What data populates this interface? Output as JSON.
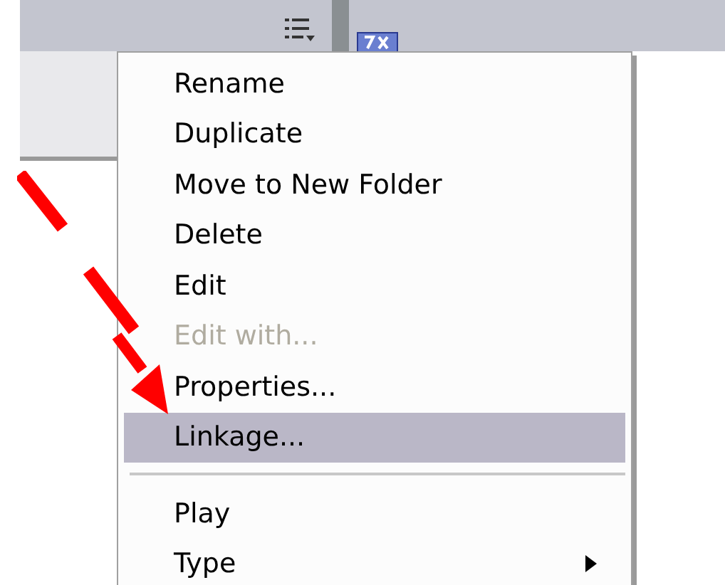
{
  "context_menu": {
    "items": [
      {
        "kind": "item",
        "label": "Rename",
        "disabled": false,
        "selected": false,
        "submenu": false
      },
      {
        "kind": "item",
        "label": "Duplicate",
        "disabled": false,
        "selected": false,
        "submenu": false
      },
      {
        "kind": "item",
        "label": "Move to New Folder",
        "disabled": false,
        "selected": false,
        "submenu": false
      },
      {
        "kind": "item",
        "label": "Delete",
        "disabled": false,
        "selected": false,
        "submenu": false
      },
      {
        "kind": "item",
        "label": "Edit",
        "disabled": false,
        "selected": false,
        "submenu": false
      },
      {
        "kind": "item",
        "label": "Edit with...",
        "disabled": true,
        "selected": false,
        "submenu": false
      },
      {
        "kind": "item",
        "label": "Properties...",
        "disabled": false,
        "selected": false,
        "submenu": false
      },
      {
        "kind": "item",
        "label": "Linkage...",
        "disabled": false,
        "selected": true,
        "submenu": false
      },
      {
        "kind": "separator"
      },
      {
        "kind": "item",
        "label": "Play",
        "disabled": false,
        "selected": false,
        "submenu": false
      },
      {
        "kind": "item",
        "label": "Type",
        "disabled": false,
        "selected": false,
        "submenu": true
      }
    ]
  }
}
